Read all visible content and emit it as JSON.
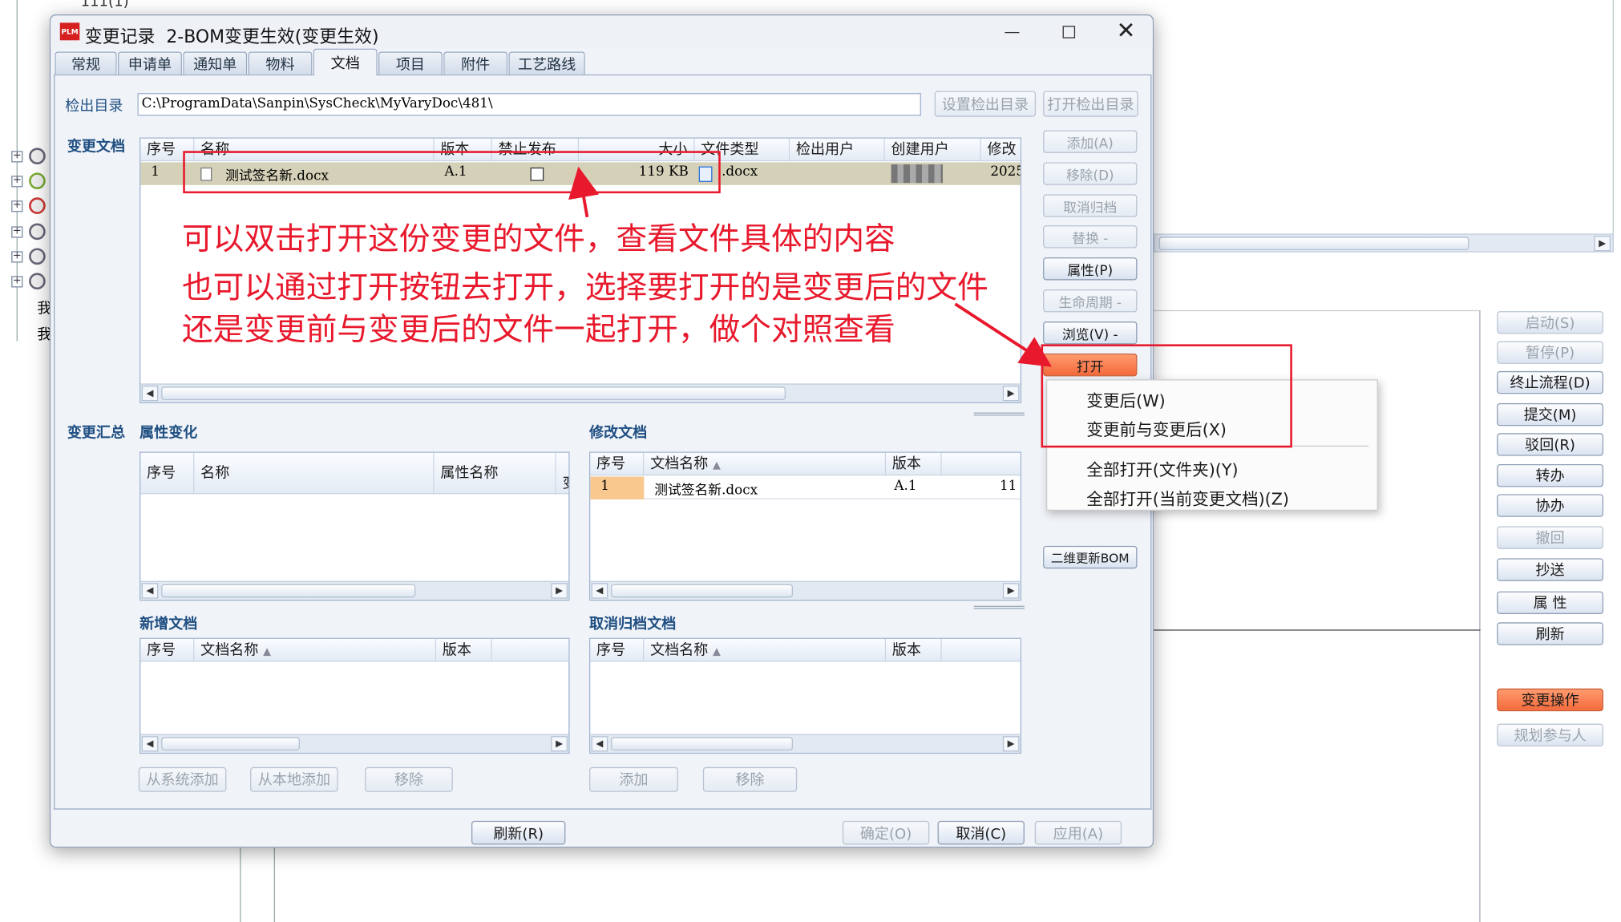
{
  "window": {
    "title": "变更记录  2-BOM变更生效(变更生效)",
    "app_icon": "PLM"
  },
  "background": {
    "tree_top": "111(1)",
    "tree_items": [
      "我",
      "我"
    ],
    "right_buttons": [
      {
        "label": "启动(S)",
        "disabled": true
      },
      {
        "label": "暂停(P)",
        "disabled": true
      },
      {
        "label": "终止流程(D)",
        "disabled": false
      },
      {
        "label": "提交(M)",
        "disabled": false
      },
      {
        "label": "驳回(R)",
        "disabled": false
      },
      {
        "label": "转办",
        "disabled": false
      },
      {
        "label": "协办",
        "disabled": false
      },
      {
        "label": "撤回",
        "disabled": true
      },
      {
        "label": "抄送",
        "disabled": false
      },
      {
        "label": "属  性",
        "disabled": false
      },
      {
        "label": "刷新",
        "disabled": false
      },
      {
        "label": "变更操作",
        "disabled": false,
        "accent": true
      },
      {
        "label": "规划参与人",
        "disabled": true
      }
    ]
  },
  "tabs": [
    "常规",
    "申请单",
    "通知单",
    "物料",
    "文档",
    "项目",
    "附件",
    "工艺路线"
  ],
  "active_tab": "文档",
  "checkout": {
    "label": "检出目录",
    "path": "C:\\ProgramData\\Sanpin\\SysCheck\\MyVaryDoc\\481\\",
    "set_btn": "设置检出目录",
    "open_btn": "打开检出目录"
  },
  "change_docs": {
    "label": "变更文档",
    "columns": [
      "序号",
      "名称",
      "版本",
      "禁止发布",
      "大小",
      "文件类型",
      "检出用户",
      "创建用户",
      "修改"
    ],
    "rows": [
      {
        "seq": "1",
        "name": "测试签名新.docx",
        "version": "A.1",
        "size": "119 KB",
        "type": ".docx",
        "date": "2025"
      }
    ]
  },
  "side_buttons": [
    {
      "label": "添加(A)",
      "disabled": true
    },
    {
      "label": "移除(D)",
      "disabled": true
    },
    {
      "label": "取消归档",
      "disabled": true
    },
    {
      "label": "替换 -",
      "disabled": true
    },
    {
      "label": "属性(P)",
      "disabled": false
    },
    {
      "label": "生命周期 -",
      "disabled": true
    },
    {
      "label": "浏览(V) -",
      "disabled": false
    },
    {
      "label": "打开",
      "disabled": false
    },
    {
      "label": "二维更新BOM",
      "disabled": false
    }
  ],
  "open_menu": {
    "items": [
      "变更后(W)",
      "变更前与变更后(X)",
      "全部打开(文件夹)(Y)",
      "全部打开(当前变更文档)(Z)"
    ]
  },
  "annotations": [
    "可以双击打开这份变更的文件，查看文件具体的内容",
    "也可以通过打开按钮去打开，选择要打开的是变更后的文件",
    "还是变更前与变更后的文件一起打开，做个对照查看"
  ],
  "summary": {
    "label": "变更汇总",
    "sublabel": "属性变化",
    "columns": [
      "序号",
      "名称",
      "属性名称",
      "变"
    ]
  },
  "modified_docs": {
    "label": "修改文档",
    "columns": [
      "序号",
      "文档名称",
      "版本",
      ""
    ],
    "rows": [
      {
        "seq": "1",
        "name": "测试签名新.docx",
        "version": "A.1",
        "extra": "11"
      }
    ]
  },
  "new_docs": {
    "label": "新增文档",
    "columns": [
      "序号",
      "文档名称",
      "版本"
    ],
    "buttons": [
      "从系统添加",
      "从本地添加",
      "移除"
    ]
  },
  "cancel_docs": {
    "label": "取消归档文档",
    "columns": [
      "序号",
      "文档名称",
      "版本"
    ],
    "buttons": [
      "添加",
      "移除"
    ]
  },
  "footer": {
    "refresh": "刷新(R)",
    "ok": "确定(O)",
    "cancel": "取消(C)",
    "apply": "应用(A)"
  }
}
